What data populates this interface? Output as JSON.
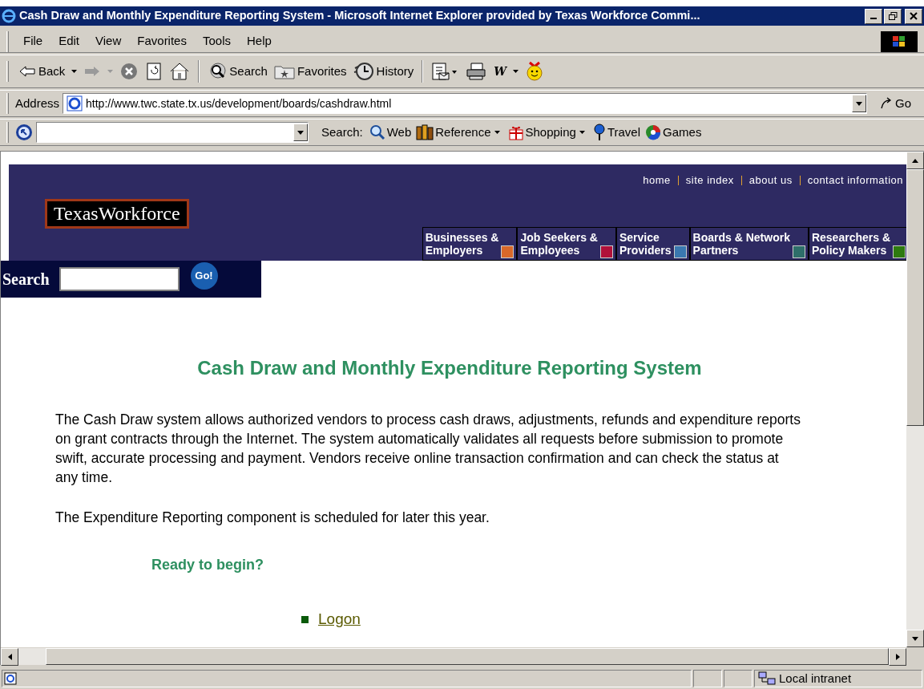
{
  "window": {
    "title": "Cash Draw and Monthly Expenditure Reporting System - Microsoft Internet Explorer provided by Texas Workforce Commi..."
  },
  "menu": [
    "File",
    "Edit",
    "View",
    "Favorites",
    "Tools",
    "Help"
  ],
  "toolbar": [
    {
      "kind": "back",
      "label": "Back"
    },
    {
      "kind": "forward"
    },
    {
      "kind": "stop"
    },
    {
      "kind": "refresh"
    },
    {
      "kind": "home"
    },
    {
      "kind": "search",
      "label": "Search"
    },
    {
      "kind": "favorites",
      "label": "Favorites"
    },
    {
      "kind": "history",
      "label": "History"
    },
    {
      "kind": "mail"
    },
    {
      "kind": "print"
    },
    {
      "kind": "edit",
      "label": "W"
    },
    {
      "kind": "messenger"
    }
  ],
  "address": {
    "label": "Address",
    "url": "http://www.twc.state.tx.us/development/boards/cashdraw.html",
    "go": "Go"
  },
  "links_bar": {
    "search_label": "Search:",
    "items": [
      {
        "label": "Web",
        "dropdown": false
      },
      {
        "label": "Reference",
        "dropdown": true
      },
      {
        "label": "Shopping",
        "dropdown": true
      },
      {
        "label": "Travel",
        "dropdown": false
      },
      {
        "label": "Games",
        "dropdown": false
      }
    ]
  },
  "page": {
    "top_links": [
      "home",
      "site index",
      "about us",
      "contact information"
    ],
    "logo": "TexasWorkforce",
    "nav": [
      {
        "lines": [
          "Businesses &",
          "Employers"
        ],
        "color": "#d8682a"
      },
      {
        "lines": [
          "Job Seekers &",
          "Employees"
        ],
        "color": "#b0103a"
      },
      {
        "lines": [
          "Service",
          "Providers"
        ],
        "color": "#3a78b0"
      },
      {
        "lines": [
          "Boards & Network",
          "Partners"
        ],
        "color": "#2e6e6a"
      },
      {
        "lines": [
          "Researchers &",
          "Policy Makers"
        ],
        "color": "#2e7a10"
      }
    ],
    "search": {
      "label": "Search",
      "button": "Go!"
    },
    "heading": "Cash Draw and Monthly Expenditure Reporting System",
    "paragraphs": [
      "The Cash Draw system allows authorized vendors to process cash draws, adjustments, refunds and expenditure reports on grant contracts through the Internet. The system automatically validates all requests before submission to promote swift, accurate processing and payment. Vendors receive online transaction confirmation and can check the status at any time.",
      "The Expenditure Reporting component is scheduled for later this year."
    ],
    "prompt": "Ready to begin?",
    "links": [
      "Logon"
    ]
  },
  "status_bar": {
    "zone": "Local intranet"
  }
}
